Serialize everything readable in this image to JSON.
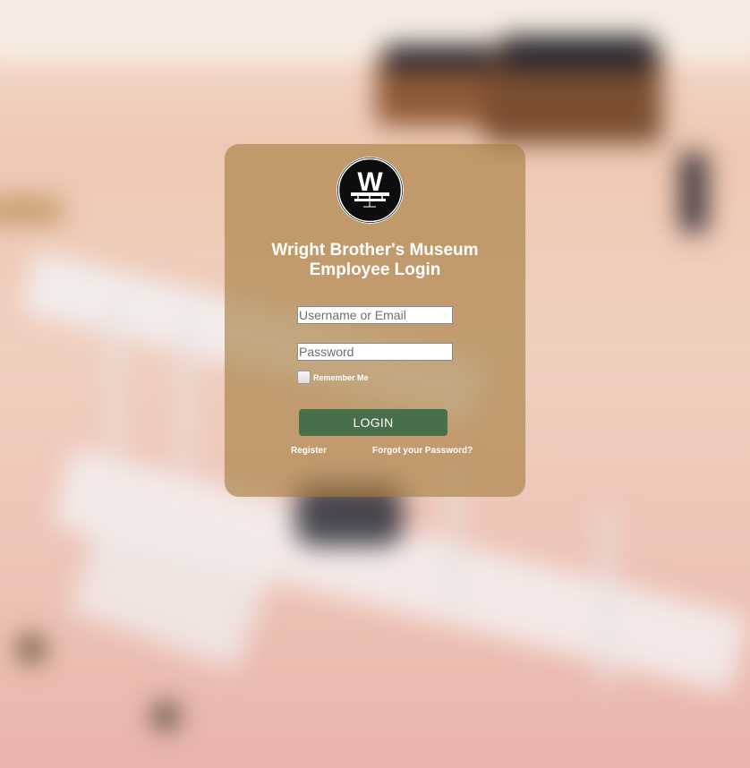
{
  "login": {
    "title_line1": "Wright Brother's Museum",
    "title_line2": "Employee Login",
    "username_placeholder": "Username or Email",
    "password_placeholder": "Password",
    "remember_label": "Remember Me",
    "login_button_label": "LOGIN",
    "register_link": "Register",
    "forgot_link": "Forgot your Password?"
  },
  "logo": {
    "letter": "W",
    "icon": "wright-airplane-logo-icon"
  },
  "background": {
    "description_icon": "blurred-wright-flyer-background"
  },
  "colors": {
    "card": "#a57c3e",
    "login_button": "#486f4b",
    "text": "#ffffff"
  }
}
